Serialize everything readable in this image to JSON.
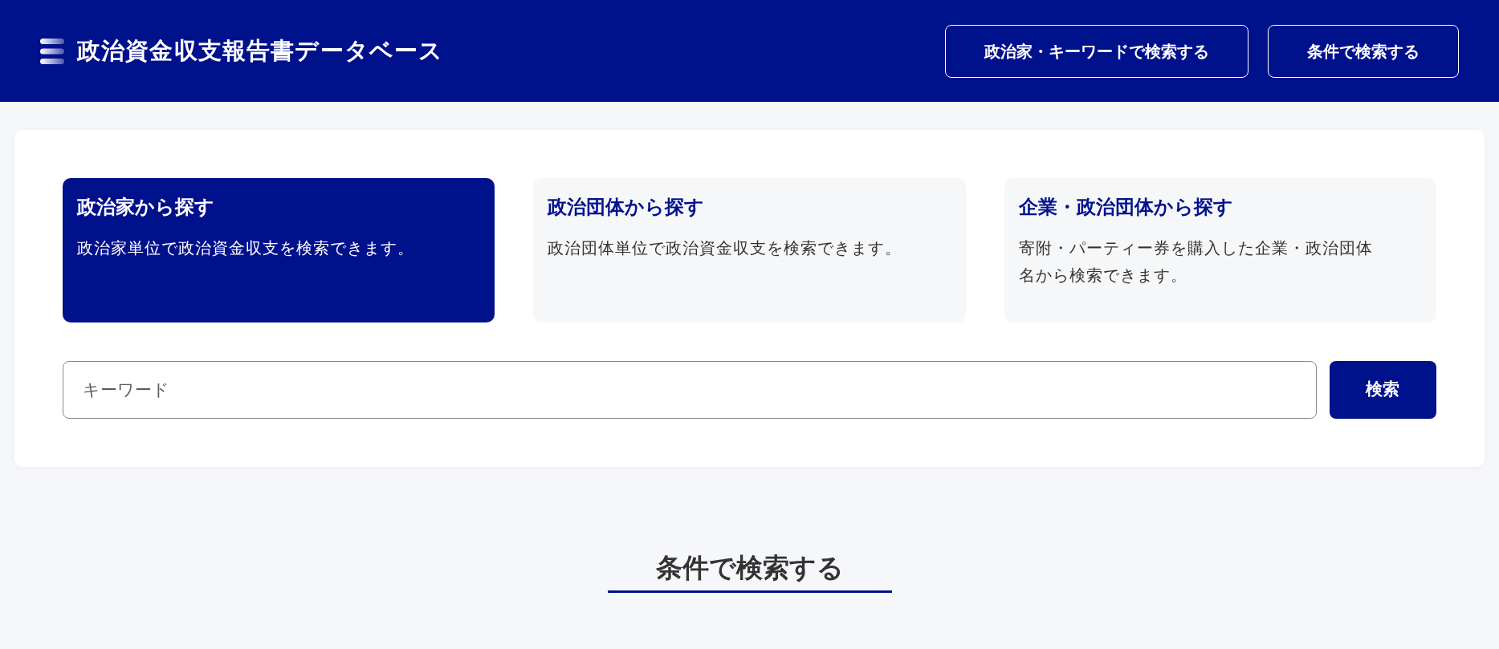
{
  "header": {
    "logo_text": "政治資金収支報告書データベース",
    "nav_buttons": [
      "政治家・キーワードで検索する",
      "条件で検索する"
    ]
  },
  "search_modes": [
    {
      "title": "政治家から探す",
      "description": "政治家単位で政治資金収支を検索できます。",
      "selected": true
    },
    {
      "title": "政治団体から探す",
      "description": "政治団体単位で政治資金収支を検索できます。",
      "selected": false
    },
    {
      "title": "企業・政治団体から探す",
      "description": "寄附・パーティー券を購入した企業・政治団体名から検索できます。",
      "selected": false
    }
  ],
  "search": {
    "placeholder": "キーワード",
    "button": "検索"
  },
  "section_title": "条件で検索する"
}
